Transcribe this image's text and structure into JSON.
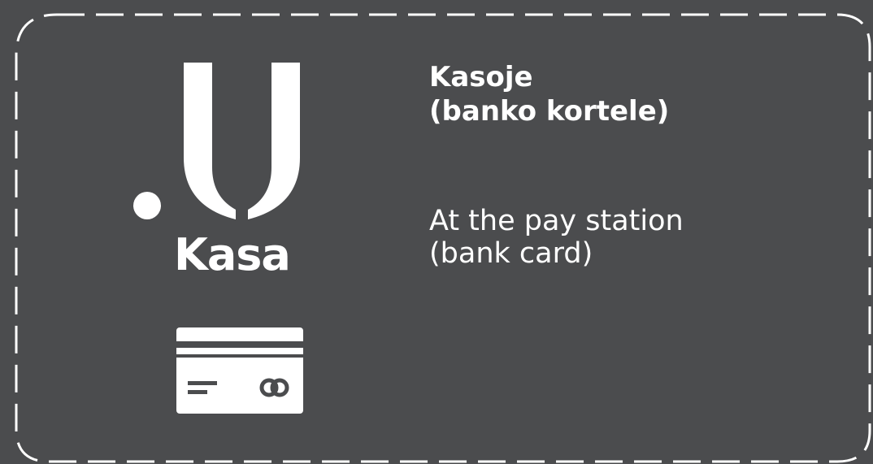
{
  "colors": {
    "background": "#4b4c4e",
    "foreground": "#ffffff"
  },
  "logo": {
    "wordmark": "Kasa",
    "mark_icon": "dot-u-icon"
  },
  "card_icon": "bank-card-icon",
  "label_lt": {
    "line1": "Kasoje",
    "line2": "(banko kortele)"
  },
  "label_en": {
    "line1": "At the pay station",
    "line2": "(bank card)"
  }
}
